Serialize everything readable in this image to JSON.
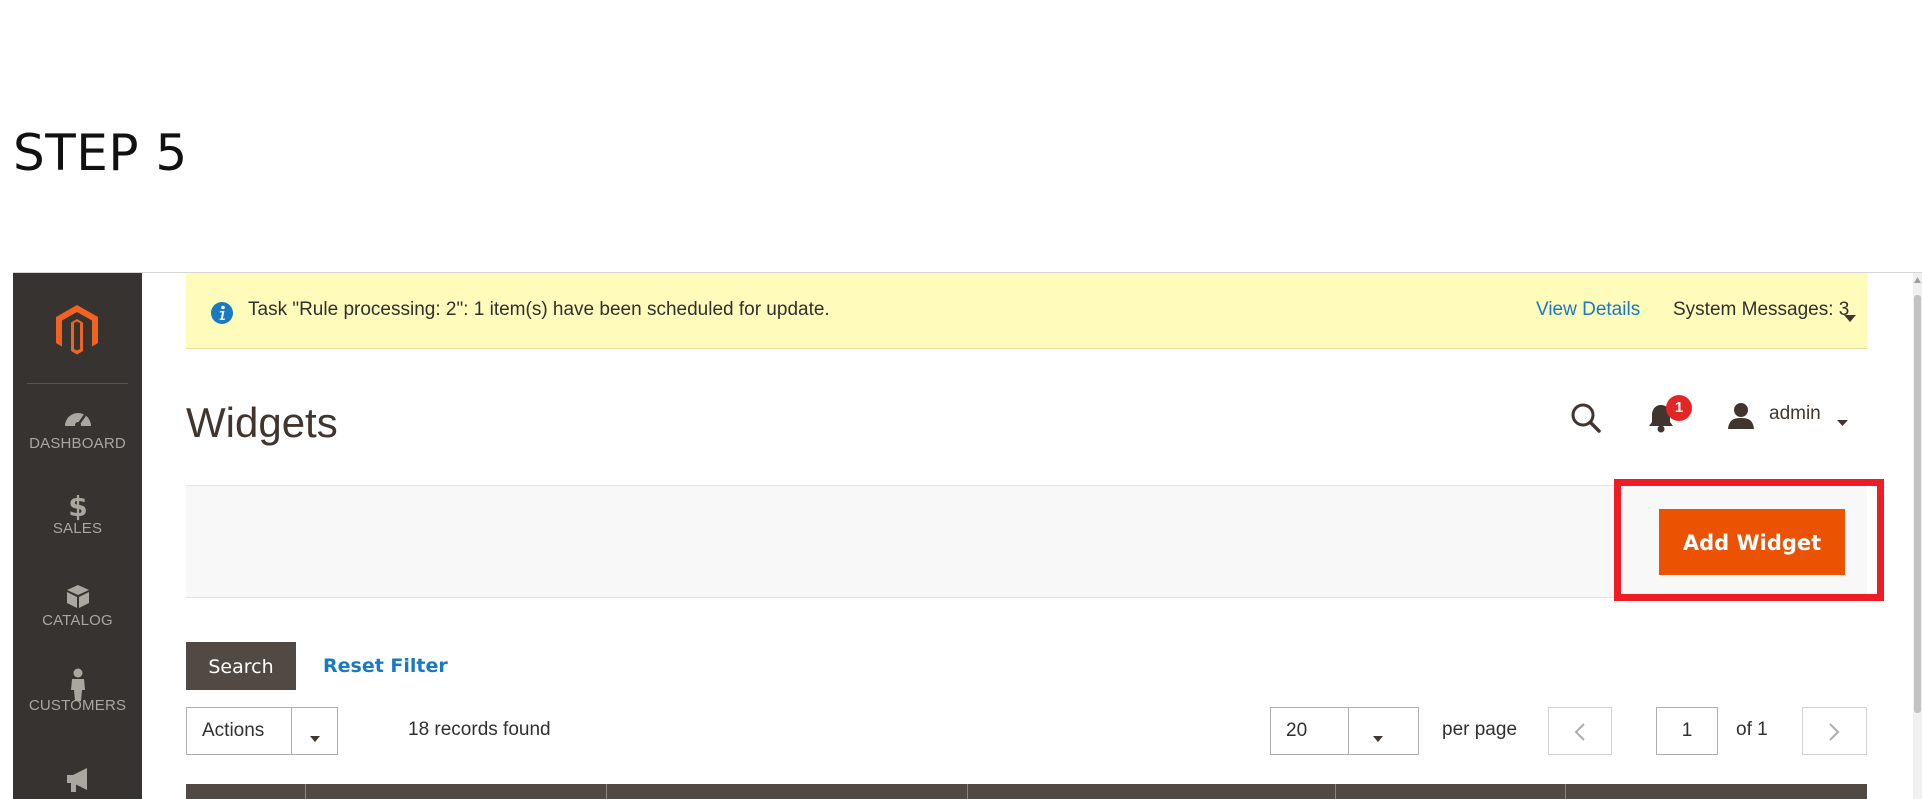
{
  "step_title": "STEP 5",
  "sidebar": {
    "items": [
      {
        "label": "DASHBOARD",
        "icon": "dashboard-icon"
      },
      {
        "label": "SALES",
        "icon": "dollar-icon"
      },
      {
        "label": "CATALOG",
        "icon": "box-icon"
      },
      {
        "label": "CUSTOMERS",
        "icon": "person-icon"
      },
      {
        "label": "",
        "icon": "megaphone-icon"
      }
    ]
  },
  "notice": {
    "text": "Task \"Rule processing: 2\": 1 item(s) have been scheduled for update.",
    "view_details": "View Details",
    "system_messages": "System Messages: 3"
  },
  "header": {
    "title": "Widgets",
    "notification_count": "1",
    "user": "admin"
  },
  "toolbar": {
    "add_widget_label": "Add Widget"
  },
  "grid": {
    "search_label": "Search",
    "reset_filter_label": "Reset Filter",
    "actions_label": "Actions",
    "records_found": "18 records found",
    "per_page_value": "20",
    "per_page_label": "per page",
    "current_page": "1",
    "page_total": "of 1"
  },
  "colors": {
    "sidebar_bg": "#373330",
    "notice_bg": "#fffbbb",
    "accent_orange": "#eb5202",
    "link_blue": "#1979c3",
    "highlight_red": "#ee1c24",
    "button_dark": "#514943"
  }
}
